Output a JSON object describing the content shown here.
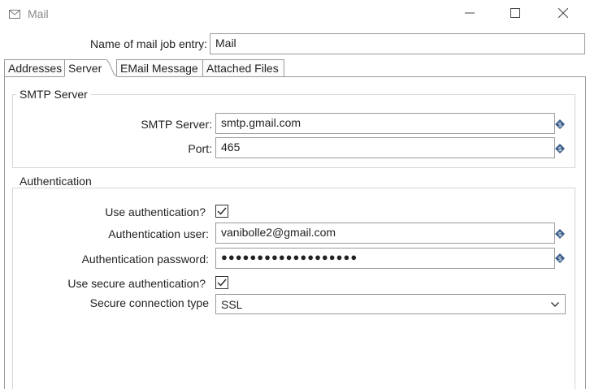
{
  "window": {
    "title": "Mail",
    "icons": {
      "app": "mail-icon",
      "minimize": "minimize-icon",
      "maximize": "maximize-icon",
      "close": "close-icon"
    }
  },
  "job_entry": {
    "label": "Name of mail job entry:",
    "value": "Mail"
  },
  "tabs": [
    {
      "label": "Addresses"
    },
    {
      "label": "Server"
    },
    {
      "label": "EMail Message"
    },
    {
      "label": "Attached Files"
    }
  ],
  "active_tab": "Server",
  "smtp_group": {
    "title": "SMTP Server",
    "server_label": "SMTP Server:",
    "server_value": "smtp.gmail.com",
    "port_label": "Port:",
    "port_value": "465"
  },
  "auth_group": {
    "title": "Authentication",
    "use_auth_label": "Use authentication?",
    "use_auth_checked": true,
    "user_label": "Authentication user:",
    "user_value": "vanibolle2@gmail.com",
    "password_label": "Authentication password:",
    "password_value": "●●●●●●●●●●●●●●●●●●●",
    "secure_auth_label": "Use secure authentication?",
    "secure_auth_checked": true,
    "conn_type_label": "Secure connection type",
    "conn_type_value": "SSL"
  },
  "colors": {
    "border": "#9a9a9a",
    "group_border": "#d6d6d6",
    "title_gray": "#8a8a8a",
    "variable_icon": "#3b5f8a"
  }
}
